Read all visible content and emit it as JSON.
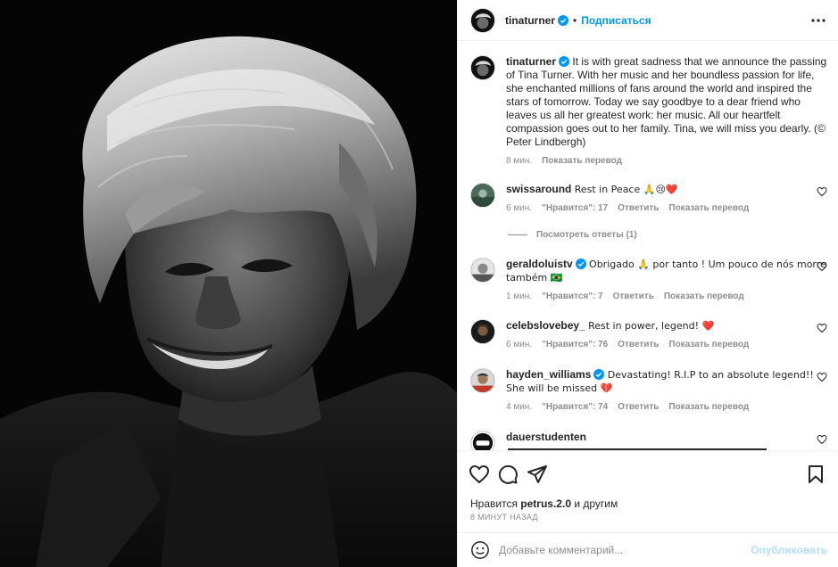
{
  "post": {
    "username": "tinaturner",
    "follow_label": "Подписаться",
    "separator": "•",
    "caption": "It is with great sadness that we announce the passing of Tina Turner. With her music and her boundless passion for life, she enchanted millions of fans around the world and inspired the stars of tomorrow. Today we say goodbye to a dear friend who leaves us all her greatest work: her music. All our heartfelt compassion goes out to her family. Tina, we will miss you dearly. (© Peter Lindbergh)",
    "caption_time": "8 мин.",
    "caption_translate": "Показать перевод"
  },
  "comments": [
    {
      "username": "swissaround",
      "verified": false,
      "text": "Rest in Peace 🙏😢❤️",
      "time": "6 мин.",
      "likes": "\"Нравится\": 17",
      "reply": "Ответить",
      "translate": "Показать перевод"
    },
    {
      "username": "geraldoluistv",
      "verified": true,
      "text": "Obrigado 🙏 por tanto ! Um pouco de nós morre também 🇧🇷",
      "time": "1 мин.",
      "likes": "\"Нравится\": 7",
      "reply": "Ответить",
      "translate": "Показать перевод"
    },
    {
      "username": "celebslovebey_",
      "verified": false,
      "text": "Rest in power, legend! ❤️",
      "time": "6 мин.",
      "likes": "\"Нравится\": 76",
      "reply": "Ответить",
      "translate": "Показать перевод"
    },
    {
      "username": "hayden_williams",
      "verified": true,
      "text": "Devastating! R.I.P to an absolute legend!! She will be missed 💔",
      "time": "4 мин.",
      "likes": "\"Нравится\": 74",
      "reply": "Ответить",
      "translate": "Показать перевод"
    },
    {
      "username": "dauerstudenten",
      "verified": false,
      "text": ""
    }
  ],
  "view_replies": "Посмотреть ответы (1)",
  "likes_line": {
    "prefix": "Нравится",
    "user": "petrus.2.0",
    "suffix": "и другим"
  },
  "time_ago": "8 МИНУТ НАЗАД",
  "add_comment": {
    "placeholder": "Добавьте комментарий...",
    "publish": "Опубликовать"
  },
  "colors": {
    "accent": "#0095f6",
    "publish_disabled": "#b2dffc",
    "muted": "#8e8e8e",
    "text": "#262626",
    "heart": "#ed4956"
  },
  "icons": [
    "more-icon",
    "heart-icon",
    "comment-icon",
    "share-icon",
    "bookmark-icon",
    "emoji-icon",
    "verified-icon"
  ]
}
